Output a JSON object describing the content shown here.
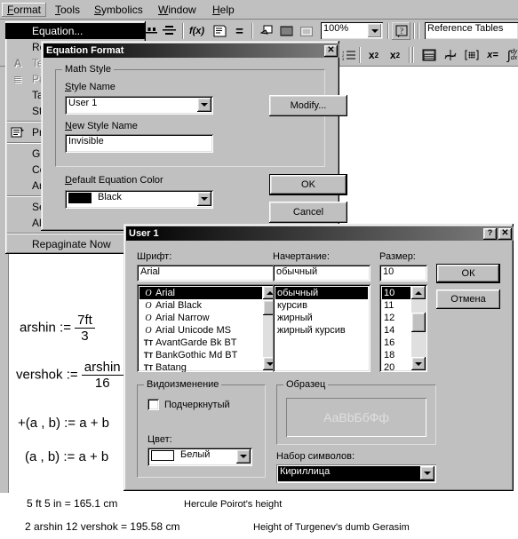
{
  "app": {
    "menubar": [
      {
        "label": "Format",
        "accel": "F",
        "active": true
      },
      {
        "label": "Tools",
        "accel": "T"
      },
      {
        "label": "Symbolics",
        "accel": "S"
      },
      {
        "label": "Window",
        "accel": "W"
      },
      {
        "label": "Help",
        "accel": "H"
      }
    ],
    "toolbar": {
      "zoom_value": "100%",
      "help_icon": "question-mark-icon",
      "style_value": "Reference Tables",
      "buttons": [
        {
          "name": "align-across-icon",
          "glyph": "▀▌▀"
        },
        {
          "name": "align-down-icon",
          "glyph": "⊨"
        },
        {
          "name": "insert-function-icon",
          "glyph": "f(x)"
        },
        {
          "name": "insert-unit-icon",
          "glyph": "🗒"
        },
        {
          "name": "calculate-icon",
          "glyph": "="
        },
        {
          "name": "insert-hyperlink-icon",
          "glyph": "🔗"
        },
        {
          "name": "insert-component-icon",
          "glyph": "▩"
        },
        {
          "name": "insert-area-icon",
          "glyph": "▭"
        }
      ],
      "buttons2": [
        {
          "name": "numbered-list-icon",
          "glyph": "≣"
        },
        {
          "name": "superscript-icon",
          "glyph": "x²"
        },
        {
          "name": "subscript-icon",
          "glyph": "x₂"
        },
        {
          "name": "calculator-palette-icon",
          "glyph": "▦"
        },
        {
          "name": "graph-palette-icon",
          "glyph": "⌁"
        },
        {
          "name": "matrix-palette-icon",
          "glyph": "⠿"
        },
        {
          "name": "evaluation-palette-icon",
          "glyph": "x="
        },
        {
          "name": "calculus-palette-icon",
          "glyph": "∫"
        }
      ]
    }
  },
  "format_menu": {
    "items": [
      {
        "label": "Equation...",
        "state": "selected",
        "icon": ""
      },
      {
        "label": "Result...",
        "state": "normal",
        "icon": ""
      },
      {
        "label": "Text...",
        "state": "disabled",
        "icon": "text-format-icon"
      },
      {
        "label": "Paragraph...",
        "state": "disabled",
        "icon": "paragraph-icon"
      },
      {
        "label": "Tabs...",
        "state": "normal",
        "icon": ""
      },
      {
        "label": "Style...",
        "state": "normal",
        "icon": ""
      },
      {
        "divider": true
      },
      {
        "label": "Properties...",
        "state": "normal",
        "icon": "properties-icon"
      },
      {
        "divider": true
      },
      {
        "label": "Graph",
        "state": "normal",
        "icon": "",
        "submenu": true
      },
      {
        "label": "Color",
        "state": "normal",
        "icon": "",
        "submenu": true
      },
      {
        "label": "Area",
        "state": "normal",
        "icon": "",
        "submenu": true
      },
      {
        "divider": true
      },
      {
        "label": "Separate Regions",
        "state": "normal",
        "icon": ""
      },
      {
        "label": "Align Regions",
        "state": "normal",
        "icon": "",
        "submenu": true
      },
      {
        "divider": true
      },
      {
        "label": "Repaginate Now",
        "state": "normal",
        "icon": ""
      }
    ]
  },
  "equation_format_dialog": {
    "title": "Equation Format",
    "close_label": "✕",
    "group_math_style": "Math Style",
    "style_name_label": "Style Name",
    "style_name_value": "User 1",
    "new_style_name_label": "New Style Name",
    "new_style_name_value": "Invisible",
    "modify_label": "Modify...",
    "default_color_label": "Default Equation Color",
    "default_color_value": "Black",
    "default_color_hex": "#000000",
    "ok_label": "OK",
    "cancel_label": "Cancel"
  },
  "font_dialog": {
    "title": "User 1",
    "help_label": "?",
    "close_label": "✕",
    "font_label": "Шрифт:",
    "font_value": "Arial",
    "font_list": [
      {
        "name": "Arial",
        "icon": "opentype-o-icon",
        "selected": true
      },
      {
        "name": "Arial Black",
        "icon": "opentype-o-icon"
      },
      {
        "name": "Arial Narrow",
        "icon": "opentype-o-icon"
      },
      {
        "name": "Arial Unicode MS",
        "icon": "opentype-o-icon"
      },
      {
        "name": "AvantGarde Bk BT",
        "icon": "truetype-tt-icon"
      },
      {
        "name": "BankGothic Md BT",
        "icon": "truetype-tt-icon"
      },
      {
        "name": "Batang",
        "icon": "truetype-tt-icon"
      }
    ],
    "style_label": "Начертание:",
    "style_value": "обычный",
    "style_list": [
      {
        "name": "обычный",
        "selected": true
      },
      {
        "name": "курсив"
      },
      {
        "name": "жирный"
      },
      {
        "name": "жирный курсив"
      }
    ],
    "size_label": "Размер:",
    "size_value": "10",
    "size_list": [
      {
        "name": "10",
        "selected": true
      },
      {
        "name": "11"
      },
      {
        "name": "12"
      },
      {
        "name": "14"
      },
      {
        "name": "16"
      },
      {
        "name": "18"
      },
      {
        "name": "20"
      }
    ],
    "ok_label": "ОК",
    "cancel_label": "Отмена",
    "effects_group": "Видоизменение",
    "underline_label": "Подчеркнутый",
    "underline_checked": false,
    "color_label": "Цвет:",
    "color_value": "Белый",
    "color_hex": "#ffffff",
    "sample_group": "Образец",
    "sample_text": "АаBbБбФф",
    "script_label": "Набор символов:",
    "script_value": "Кириллица"
  },
  "document": {
    "equations": [
      {
        "lhs": "arshin :=",
        "num": "7ft",
        "den": "3",
        "kind": "fraction"
      },
      {
        "lhs": "vershok :=",
        "num": "arshin",
        "den": "16",
        "kind": "fraction"
      },
      {
        "text": "+(a , b) := a + b",
        "kind": "plain"
      },
      {
        "text": "(a , b) := a + b",
        "kind": "plain"
      }
    ],
    "results": [
      {
        "expr": "5 ft  5 in  =  165.1 cm",
        "note": "Hercule Poirot's height"
      },
      {
        "expr": "2 arshin  12 vershok  =  195.58 cm",
        "note": "Height of Turgenev's dumb Gerasim"
      }
    ]
  }
}
